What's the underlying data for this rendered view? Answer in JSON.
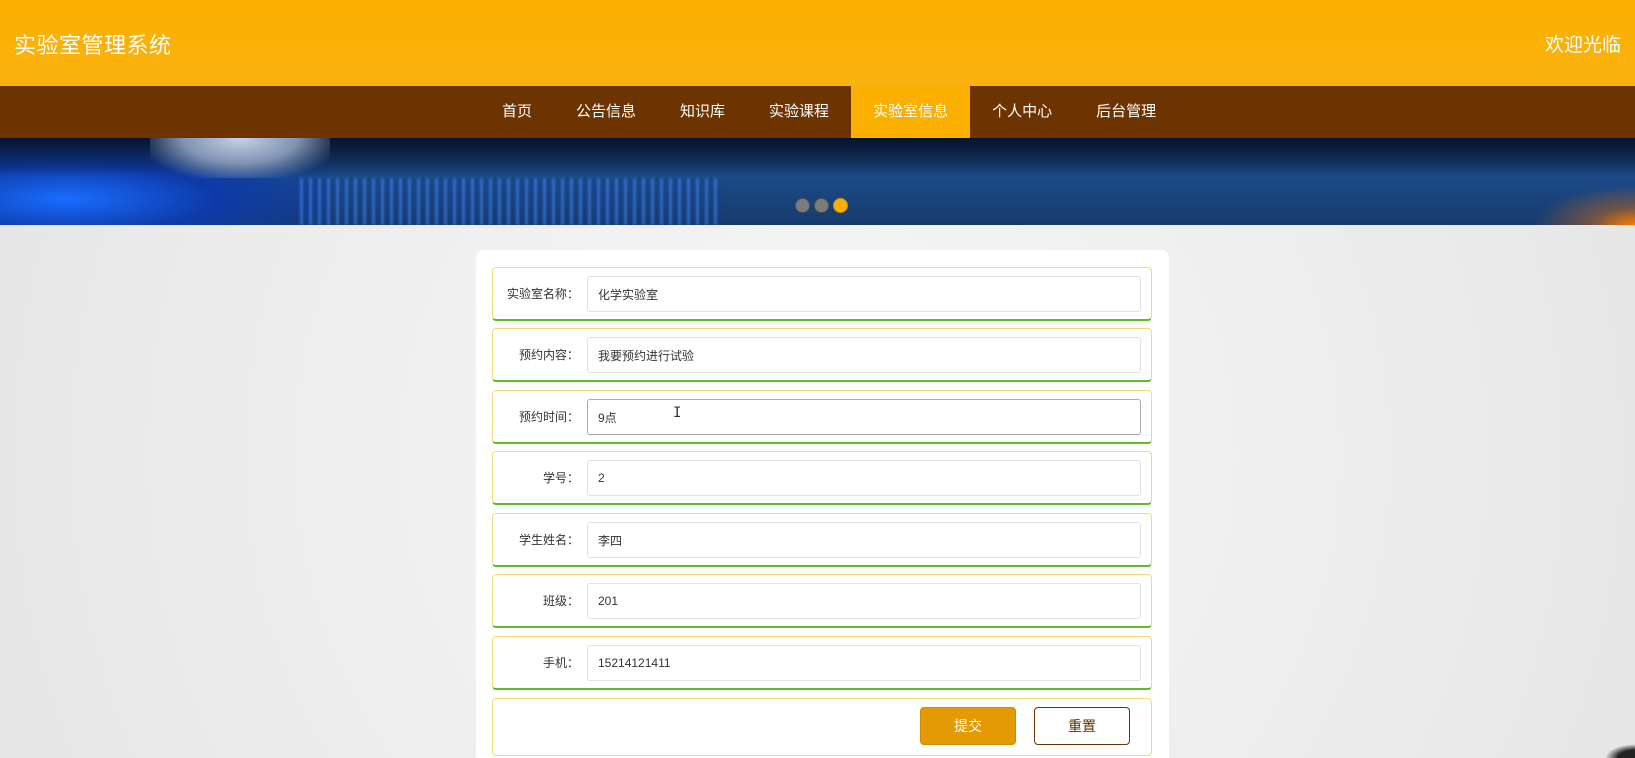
{
  "header": {
    "site_title": "实验室管理系统",
    "welcome": "欢迎光临",
    "background_color": "#fbb000"
  },
  "nav": {
    "background_color": "#6d3300",
    "active_color": "#fbb000",
    "items": [
      {
        "label": "首页",
        "active": false
      },
      {
        "label": "公告信息",
        "active": false
      },
      {
        "label": "知识库",
        "active": false
      },
      {
        "label": "实验课程",
        "active": false
      },
      {
        "label": "实验室信息",
        "active": true
      },
      {
        "label": "个人中心",
        "active": false
      },
      {
        "label": "后台管理",
        "active": false
      }
    ]
  },
  "banner": {
    "slide_count": 3,
    "active_slide": 3
  },
  "form": {
    "fields": [
      {
        "label": "实验室名称：",
        "value": "化学实验室"
      },
      {
        "label": "预约内容：",
        "value": "我要预约进行试验"
      },
      {
        "label": "预约时间：",
        "value": "9点"
      },
      {
        "label": "学号：",
        "value": "2"
      },
      {
        "label": "学生姓名：",
        "value": "李四"
      },
      {
        "label": "班级：",
        "value": "201"
      },
      {
        "label": "手机：",
        "value": "15214121411"
      }
    ],
    "submit_label": "提交",
    "reset_label": "重置",
    "row_border_color": "#5dbb2b",
    "submit_color": "#e39a05"
  }
}
